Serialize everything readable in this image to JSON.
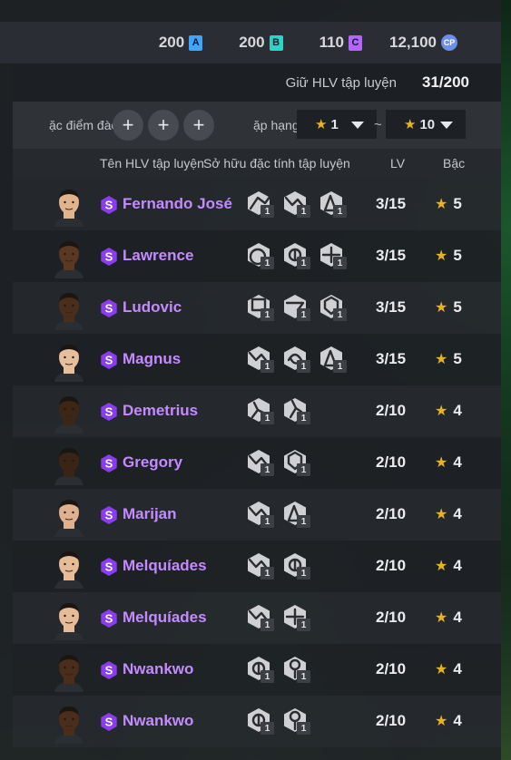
{
  "currency": [
    {
      "value": "200",
      "badge": "A",
      "color": "#3fa6ff"
    },
    {
      "value": "200",
      "badge": "B",
      "color": "#2fd2c4"
    },
    {
      "value": "110",
      "badge": "C",
      "color": "#b565ff"
    },
    {
      "value": "12,100",
      "badge": "CP",
      "color": "#6d8fe8"
    }
  ],
  "coach_keep": {
    "label": "Giữ HLV tập luyện",
    "value": "31/200"
  },
  "filter": {
    "trait_label": "ặc điểm đào",
    "rank_label": "ặp hạng",
    "plus_symbol": "+",
    "min_rank": "1",
    "max_rank": "10",
    "separator": "~"
  },
  "columns": {
    "name": "Tên HLV tập luyện",
    "traits": "Sở hữu đặc tính tập luyện",
    "lv": "LV",
    "grade": "Bậc"
  },
  "coaches": [
    {
      "name": "Fernando José",
      "lv": "3/15",
      "grade": "5",
      "traits": [
        "pass-trait-icon",
        "dribble-trait-icon",
        "defend-trait-icon"
      ],
      "trait_counts": [
        "1",
        "1",
        "1"
      ],
      "skin": "#e2b48e"
    },
    {
      "name": "Lawrence",
      "lv": "3/15",
      "grade": "5",
      "traits": [
        "shoot-trait-icon",
        "ball-trait-icon",
        "pressure-trait-icon"
      ],
      "trait_counts": [
        "1",
        "1",
        "1"
      ],
      "skin": "#5a3822"
    },
    {
      "name": "Ludovic",
      "lv": "3/15",
      "grade": "5",
      "traits": [
        "gk-trait-icon",
        "cross-trait-icon",
        "shield-trait-icon"
      ],
      "trait_counts": [
        "1",
        "1",
        "1"
      ],
      "skin": "#4a2e1c"
    },
    {
      "name": "Magnus",
      "lv": "3/15",
      "grade": "5",
      "traits": [
        "dribble-trait-icon",
        "spin-trait-icon",
        "defend-trait-icon"
      ],
      "trait_counts": [
        "1",
        "1",
        "1"
      ],
      "skin": "#e8bf9c"
    },
    {
      "name": "Demetrius",
      "lv": "2/10",
      "grade": "4",
      "traits": [
        "tackle-trait-icon",
        "run-trait-icon"
      ],
      "trait_counts": [
        "1",
        "1"
      ],
      "skin": "#3e2617"
    },
    {
      "name": "Gregory",
      "lv": "2/10",
      "grade": "4",
      "traits": [
        "dribble-trait-icon",
        "shield-trait-icon"
      ],
      "trait_counts": [
        "1",
        "1"
      ],
      "skin": "#3a2416"
    },
    {
      "name": "Marijan",
      "lv": "2/10",
      "grade": "4",
      "traits": [
        "dribble-trait-icon",
        "defend-trait-icon"
      ],
      "trait_counts": [
        "1",
        "1"
      ],
      "skin": "#e0b18f"
    },
    {
      "name": "Melquíades",
      "lv": "2/10",
      "grade": "4",
      "traits": [
        "dribble-trait-icon",
        "ball-trait-icon"
      ],
      "trait_counts": [
        "1",
        "1"
      ],
      "skin": "#e6bb98"
    },
    {
      "name": "Melquíades",
      "lv": "2/10",
      "grade": "4",
      "traits": [
        "dribble-trait-icon",
        "pressure-trait-icon"
      ],
      "trait_counts": [
        "1",
        "1"
      ],
      "skin": "#e6bb98"
    },
    {
      "name": "Nwankwo",
      "lv": "2/10",
      "grade": "4",
      "traits": [
        "ball-trait-icon",
        "head-trait-icon"
      ],
      "trait_counts": [
        "1",
        "1"
      ],
      "skin": "#4a2d1a"
    },
    {
      "name": "Nwankwo",
      "lv": "2/10",
      "grade": "4",
      "traits": [
        "ball-trait-icon",
        "head-trait-icon"
      ],
      "trait_counts": [
        "1",
        "1"
      ],
      "skin": "#4a2d1a"
    }
  ]
}
